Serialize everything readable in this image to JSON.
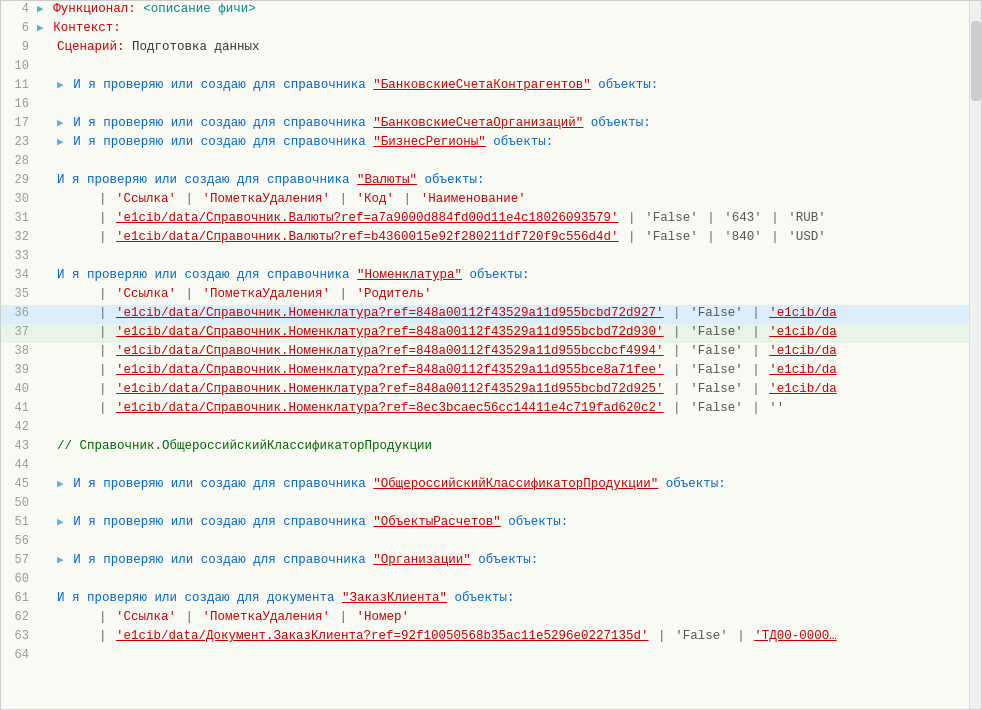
{
  "editor": {
    "lines": [
      {
        "num": "4",
        "indent": 0,
        "arrow": true,
        "content": [
          {
            "type": "keyword-red",
            "text": "Функционал:"
          },
          {
            "type": "normal",
            "text": " "
          },
          {
            "type": "keyword-cyan",
            "text": "<описание фичи>"
          }
        ]
      },
      {
        "num": "6",
        "indent": 0,
        "arrow": true,
        "content": [
          {
            "type": "keyword-red",
            "text": "Контекст:"
          }
        ]
      },
      {
        "num": "9",
        "indent": 1,
        "content": [
          {
            "type": "keyword-red",
            "text": "Сценарий:"
          },
          {
            "type": "normal",
            "text": " Подготовка данных"
          }
        ]
      },
      {
        "num": "10",
        "indent": 0,
        "content": []
      },
      {
        "num": "11",
        "indent": 1,
        "arrow": true,
        "content": [
          {
            "type": "keyword-blue",
            "text": "И я проверяю или создаю для справочника"
          },
          {
            "type": "normal",
            "text": " "
          },
          {
            "type": "link",
            "text": "\"БанковскиеСчетаКонтрагентов\""
          },
          {
            "type": "keyword-blue",
            "text": " объекты:"
          }
        ]
      },
      {
        "num": "16",
        "indent": 0,
        "content": []
      },
      {
        "num": "17",
        "indent": 1,
        "arrow": true,
        "content": [
          {
            "type": "keyword-blue",
            "text": "И я проверяю или создаю для справочника"
          },
          {
            "type": "normal",
            "text": " "
          },
          {
            "type": "link",
            "text": "\"БанковскиеСчетаОрганизаций\""
          },
          {
            "type": "keyword-blue",
            "text": " объекты:"
          }
        ]
      },
      {
        "num": "23",
        "indent": 1,
        "arrow": true,
        "content": [
          {
            "type": "keyword-blue",
            "text": "И я проверяю или создаю для справочника"
          },
          {
            "type": "normal",
            "text": " "
          },
          {
            "type": "link",
            "text": "\"БизнесРегионы\""
          },
          {
            "type": "keyword-blue",
            "text": " объекты:"
          }
        ]
      },
      {
        "num": "28",
        "indent": 0,
        "content": []
      },
      {
        "num": "29",
        "indent": 1,
        "content": [
          {
            "type": "keyword-blue",
            "text": "И я проверяю или создаю для справочника"
          },
          {
            "type": "normal",
            "text": " "
          },
          {
            "type": "link",
            "text": "\"Валюты\""
          },
          {
            "type": "keyword-blue",
            "text": " объекты:"
          }
        ]
      },
      {
        "num": "30",
        "indent": 2,
        "content": [
          {
            "type": "pipe",
            "text": "| "
          },
          {
            "type": "label",
            "text": "'Ссылка'"
          },
          {
            "type": "pipe",
            "text": "                                                                            | "
          },
          {
            "type": "label",
            "text": "'ПометкаУдаления'"
          },
          {
            "type": "pipe",
            "text": " | "
          },
          {
            "type": "label",
            "text": "'Код'"
          },
          {
            "type": "pipe",
            "text": " | "
          },
          {
            "type": "label",
            "text": "'Наименование'"
          }
        ]
      },
      {
        "num": "31",
        "indent": 2,
        "content": [
          {
            "type": "pipe",
            "text": "| "
          },
          {
            "type": "link",
            "text": "'e1cib/data/Справочник.Валюты?ref=a7a9000d884fd00d11e4c18026093579'"
          },
          {
            "type": "pipe",
            "text": " | "
          },
          {
            "type": "value",
            "text": "'False'"
          },
          {
            "type": "pipe",
            "text": "            | "
          },
          {
            "type": "value",
            "text": "'643'"
          },
          {
            "type": "pipe",
            "text": " | "
          },
          {
            "type": "value",
            "text": "'RUB'"
          }
        ]
      },
      {
        "num": "32",
        "indent": 2,
        "content": [
          {
            "type": "pipe",
            "text": "| "
          },
          {
            "type": "link",
            "text": "'e1cib/data/Справочник.Валюты?ref=b4360015e92f280211df720f9c556d4d'"
          },
          {
            "type": "pipe",
            "text": " | "
          },
          {
            "type": "value",
            "text": "'False'"
          },
          {
            "type": "pipe",
            "text": "            | "
          },
          {
            "type": "value",
            "text": "'840'"
          },
          {
            "type": "pipe",
            "text": " | "
          },
          {
            "type": "value",
            "text": "'USD'"
          }
        ]
      },
      {
        "num": "33",
        "indent": 0,
        "content": []
      },
      {
        "num": "34",
        "indent": 1,
        "content": [
          {
            "type": "keyword-blue",
            "text": "И я проверяю или создаю для справочника"
          },
          {
            "type": "normal",
            "text": " "
          },
          {
            "type": "link",
            "text": "\"Номенклатура\""
          },
          {
            "type": "keyword-blue",
            "text": " объекты:"
          }
        ]
      },
      {
        "num": "35",
        "indent": 2,
        "content": [
          {
            "type": "pipe",
            "text": "| "
          },
          {
            "type": "label",
            "text": "'Ссылка'"
          },
          {
            "type": "pipe",
            "text": "                                                                    | "
          },
          {
            "type": "label",
            "text": "'ПометкаУдаления'"
          },
          {
            "type": "pipe",
            "text": " | "
          },
          {
            "type": "label",
            "text": "'Родитель'"
          }
        ]
      },
      {
        "num": "36",
        "indent": 2,
        "highlight": true,
        "content": [
          {
            "type": "pipe",
            "text": "| "
          },
          {
            "type": "link",
            "text": "'e1cib/data/Справочник.Номенклатура?ref=848a00112f43529a11d955bcbd72d927'"
          },
          {
            "type": "pipe",
            "text": " | "
          },
          {
            "type": "value",
            "text": "'False'"
          },
          {
            "type": "pipe",
            "text": "            | "
          },
          {
            "type": "link",
            "text": "'e1cib/da"
          }
        ]
      },
      {
        "num": "37",
        "indent": 2,
        "highlight2": true,
        "content": [
          {
            "type": "pipe",
            "text": "| "
          },
          {
            "type": "link",
            "text": "'e1cib/data/Справочник.Номенклатура?ref=848a00112f43529a11d955bcbd72d930'"
          },
          {
            "type": "pipe",
            "text": " | "
          },
          {
            "type": "value",
            "text": "'False'"
          },
          {
            "type": "pipe",
            "text": "            | "
          },
          {
            "type": "link",
            "text": "'e1cib/da"
          }
        ]
      },
      {
        "num": "38",
        "indent": 2,
        "content": [
          {
            "type": "pipe",
            "text": "| "
          },
          {
            "type": "link",
            "text": "'e1cib/data/Справочник.Номенклатура?ref=848a00112f43529a11d955bccbcf4994'"
          },
          {
            "type": "pipe",
            "text": " | "
          },
          {
            "type": "value",
            "text": "'False'"
          },
          {
            "type": "pipe",
            "text": "            | "
          },
          {
            "type": "link",
            "text": "'e1cib/da"
          }
        ]
      },
      {
        "num": "39",
        "indent": 2,
        "content": [
          {
            "type": "pipe",
            "text": "| "
          },
          {
            "type": "link",
            "text": "'e1cib/data/Справочник.Номенклатура?ref=848a00112f43529a11d955bce8a71fee'"
          },
          {
            "type": "pipe",
            "text": " | "
          },
          {
            "type": "value",
            "text": "'False'"
          },
          {
            "type": "pipe",
            "text": "            | "
          },
          {
            "type": "link",
            "text": "'e1cib/da"
          }
        ]
      },
      {
        "num": "40",
        "indent": 2,
        "content": [
          {
            "type": "pipe",
            "text": "| "
          },
          {
            "type": "link",
            "text": "'e1cib/data/Справочник.Номенклатура?ref=848a00112f43529a11d955bcbd72d925'"
          },
          {
            "type": "pipe",
            "text": " | "
          },
          {
            "type": "value",
            "text": "'False'"
          },
          {
            "type": "pipe",
            "text": "            | "
          },
          {
            "type": "link",
            "text": "'e1cib/da"
          }
        ]
      },
      {
        "num": "41",
        "indent": 2,
        "content": [
          {
            "type": "pipe",
            "text": "| "
          },
          {
            "type": "link",
            "text": "'e1cib/data/Справочник.Номенклатура?ref=8ec3bcaec56cc14411e4c719fad620c2'"
          },
          {
            "type": "pipe",
            "text": " | "
          },
          {
            "type": "value",
            "text": "'False'"
          },
          {
            "type": "pipe",
            "text": "            | "
          },
          {
            "type": "value",
            "text": "''"
          }
        ]
      },
      {
        "num": "42",
        "indent": 0,
        "content": []
      },
      {
        "num": "43",
        "indent": 1,
        "content": [
          {
            "type": "comment",
            "text": "// Справочник.ОбщероссийскийКлассификаторПродукции"
          }
        ]
      },
      {
        "num": "44",
        "indent": 0,
        "content": []
      },
      {
        "num": "45",
        "indent": 1,
        "arrow": true,
        "content": [
          {
            "type": "keyword-blue",
            "text": "И я проверяю или создаю для справочника"
          },
          {
            "type": "normal",
            "text": " "
          },
          {
            "type": "link",
            "text": "\"ОбщероссийскийКлассификаторПродукции\""
          },
          {
            "type": "keyword-blue",
            "text": " объекты:"
          }
        ]
      },
      {
        "num": "50",
        "indent": 0,
        "content": []
      },
      {
        "num": "51",
        "indent": 1,
        "arrow": true,
        "content": [
          {
            "type": "keyword-blue",
            "text": "И я проверяю или создаю для справочника"
          },
          {
            "type": "normal",
            "text": " "
          },
          {
            "type": "link",
            "text": "\"ОбъектыРасчетов\""
          },
          {
            "type": "keyword-blue",
            "text": " объекты:"
          }
        ]
      },
      {
        "num": "56",
        "indent": 0,
        "content": []
      },
      {
        "num": "57",
        "indent": 1,
        "arrow": true,
        "content": [
          {
            "type": "keyword-blue",
            "text": "И я проверяю или создаю для справочника"
          },
          {
            "type": "normal",
            "text": " "
          },
          {
            "type": "link",
            "text": "\"Организации\""
          },
          {
            "type": "keyword-blue",
            "text": " объекты:"
          }
        ]
      },
      {
        "num": "60",
        "indent": 0,
        "content": []
      },
      {
        "num": "61",
        "indent": 1,
        "content": [
          {
            "type": "keyword-blue",
            "text": "И я проверяю или создаю для документа"
          },
          {
            "type": "normal",
            "text": " "
          },
          {
            "type": "link",
            "text": "\"ЗаказКлиента\""
          },
          {
            "type": "keyword-blue",
            "text": " объекты:"
          }
        ]
      },
      {
        "num": "62",
        "indent": 2,
        "content": [
          {
            "type": "pipe",
            "text": "| "
          },
          {
            "type": "label",
            "text": "'Ссылка'"
          },
          {
            "type": "pipe",
            "text": "                                                                 | "
          },
          {
            "type": "label",
            "text": "'ПометкаУдаления'"
          },
          {
            "type": "pipe",
            "text": " | "
          },
          {
            "type": "label",
            "text": "'Номер'"
          }
        ]
      },
      {
        "num": "63",
        "indent": 2,
        "content": [
          {
            "type": "pipe",
            "text": "| "
          },
          {
            "type": "link",
            "text": "'e1cib/data/Документ.ЗаказКлиента?ref=92f10050568b35ac11e5296e0227135d'"
          },
          {
            "type": "pipe",
            "text": " | "
          },
          {
            "type": "value",
            "text": "'False'"
          },
          {
            "type": "pipe",
            "text": "            | "
          },
          {
            "type": "link",
            "text": "'ТД00-0000…"
          }
        ]
      },
      {
        "num": "64",
        "indent": 0,
        "content": []
      }
    ]
  }
}
